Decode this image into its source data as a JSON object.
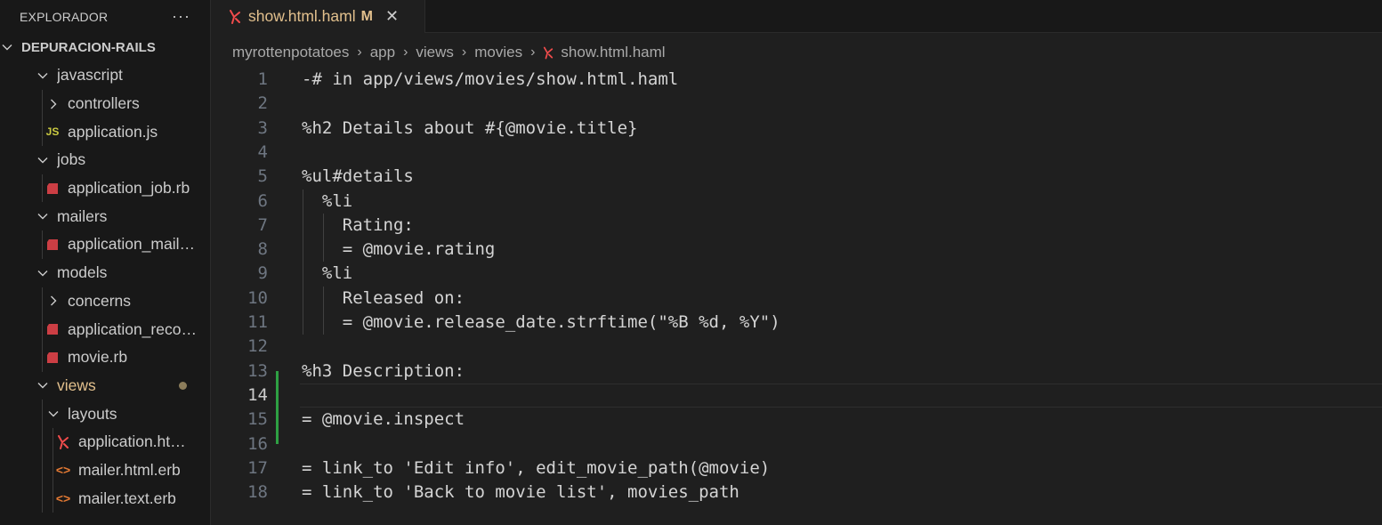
{
  "sidebar": {
    "title": "EXPLORADOR",
    "more": "···",
    "root": "DEPURACION-RAILS",
    "items": [
      {
        "label": "javascript",
        "type": "folder-open",
        "depth": 1
      },
      {
        "label": "controllers",
        "type": "folder-closed",
        "depth": 2
      },
      {
        "label": "application.js",
        "type": "js",
        "icon_text": "JS",
        "depth": 2
      },
      {
        "label": "jobs",
        "type": "folder-open",
        "depth": 1
      },
      {
        "label": "application_job.rb",
        "type": "ruby",
        "depth": 2
      },
      {
        "label": "mailers",
        "type": "folder-open",
        "depth": 1
      },
      {
        "label": "application_mail…",
        "type": "ruby",
        "depth": 2
      },
      {
        "label": "models",
        "type": "folder-open",
        "depth": 1
      },
      {
        "label": "concerns",
        "type": "folder-closed",
        "depth": 2
      },
      {
        "label": "application_reco…",
        "type": "ruby",
        "depth": 2
      },
      {
        "label": "movie.rb",
        "type": "ruby",
        "depth": 2
      },
      {
        "label": "views",
        "type": "folder-open",
        "depth": 1,
        "modified": true
      },
      {
        "label": "layouts",
        "type": "folder-open",
        "depth": 2
      },
      {
        "label": "application.ht…",
        "type": "haml",
        "depth": 3
      },
      {
        "label": "mailer.html.erb",
        "type": "erb",
        "icon_text": "<>",
        "depth": 3
      },
      {
        "label": "mailer.text.erb",
        "type": "erb",
        "icon_text": "<>",
        "depth": 3
      }
    ]
  },
  "tab": {
    "name": "show.html.haml",
    "status": "M",
    "close": "✕"
  },
  "breadcrumb": [
    "myrottenpotatoes",
    "app",
    "views",
    "movies",
    "show.html.haml"
  ],
  "editor": {
    "active_line": 14,
    "lines": [
      {
        "n": "1",
        "text": "-# in app/views/movies/show.html.haml"
      },
      {
        "n": "2",
        "text": ""
      },
      {
        "n": "3",
        "text": "%h2 Details about #{@movie.title}"
      },
      {
        "n": "4",
        "text": ""
      },
      {
        "n": "5",
        "text": "%ul#details"
      },
      {
        "n": "6",
        "text": "  %li"
      },
      {
        "n": "7",
        "text": "    Rating:"
      },
      {
        "n": "8",
        "text": "    = @movie.rating"
      },
      {
        "n": "9",
        "text": "  %li"
      },
      {
        "n": "10",
        "text": "    Released on:"
      },
      {
        "n": "11",
        "text": "    = @movie.release_date.strftime(\"%B %d, %Y\")"
      },
      {
        "n": "12",
        "text": ""
      },
      {
        "n": "13",
        "text": "%h3 Description:"
      },
      {
        "n": "14",
        "text": ""
      },
      {
        "n": "15",
        "text": "= @movie.inspect"
      },
      {
        "n": "16",
        "text": ""
      },
      {
        "n": "17",
        "text": "= link_to 'Edit info', edit_movie_path(@movie)"
      },
      {
        "n": "18",
        "text": "= link_to 'Back to movie list', movies_path"
      }
    ]
  },
  "colors": {
    "modified": "#e2c08d",
    "git_added": "#2ea043",
    "ruby": "#cc3e44",
    "haml": "#f14c4c"
  }
}
